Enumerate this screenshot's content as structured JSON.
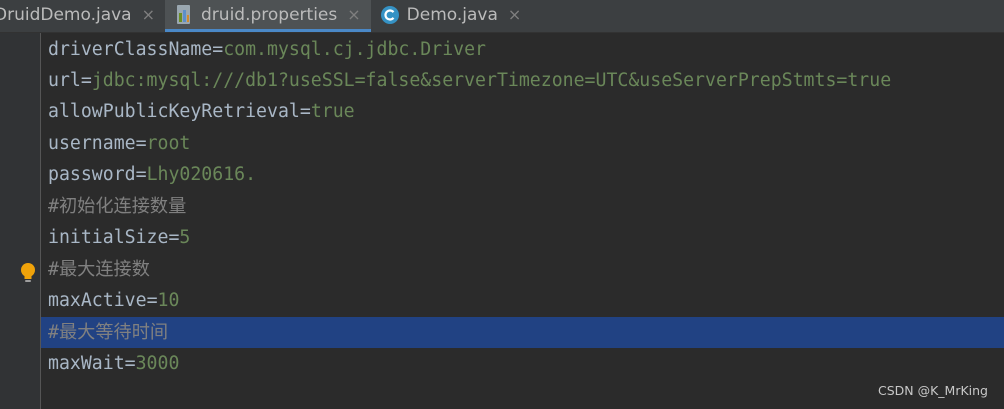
{
  "tabs": [
    {
      "label": "DruidDemo.java",
      "icon": "java-class-icon",
      "active": false
    },
    {
      "label": "druid.properties",
      "icon": "properties-file-icon",
      "active": true
    },
    {
      "label": "Demo.java",
      "icon": "java-class-icon",
      "active": false
    }
  ],
  "close_glyph": "×",
  "editor": {
    "lines": [
      {
        "key": "driverClassName",
        "eq": "=",
        "value": "com.mysql.cj.jdbc.Driver"
      },
      {
        "key": "url",
        "eq": "=",
        "value": "jdbc:mysql:///db1?useSSL=false&serverTimezone=UTC&useServerPrepStmts=true"
      },
      {
        "key": "allowPublicKeyRetrieval",
        "eq": "=",
        "value": "true"
      },
      {
        "key": "username",
        "eq": "=",
        "value": "root"
      },
      {
        "key": "password",
        "eq": "=",
        "value": "Lhy020616."
      },
      {
        "comment": "#初始化连接数量"
      },
      {
        "key": "initialSize",
        "eq": "=",
        "value": "5"
      },
      {
        "comment": "#最大连接数"
      },
      {
        "key": "maxActive",
        "eq": "=",
        "value": "10"
      },
      {
        "comment": "#最大等待时间",
        "selected": true
      },
      {
        "key": "maxWait",
        "eq": "=",
        "value": "3000"
      }
    ]
  },
  "colors": {
    "background": "#2b2b2b",
    "key": "#a9b7c6",
    "value": "#6a8759",
    "comment": "#808080",
    "selection": "#214283",
    "tab_active_underline": "#4a88c7"
  },
  "watermark": "CSDN @K_MrKing"
}
